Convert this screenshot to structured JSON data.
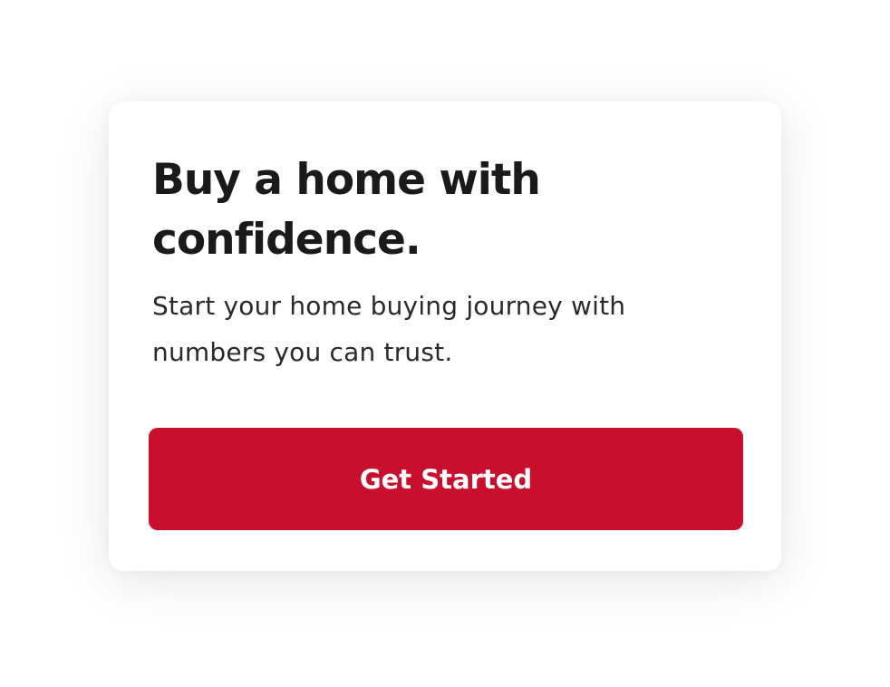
{
  "card": {
    "headline": "Buy a home with confidence.",
    "subtext": "Start your home buying journey with numbers you can trust.",
    "cta_label": "Get Started"
  },
  "colors": {
    "accent": "#c8102e",
    "text_primary": "#1a1a1a",
    "background": "#ffffff"
  }
}
